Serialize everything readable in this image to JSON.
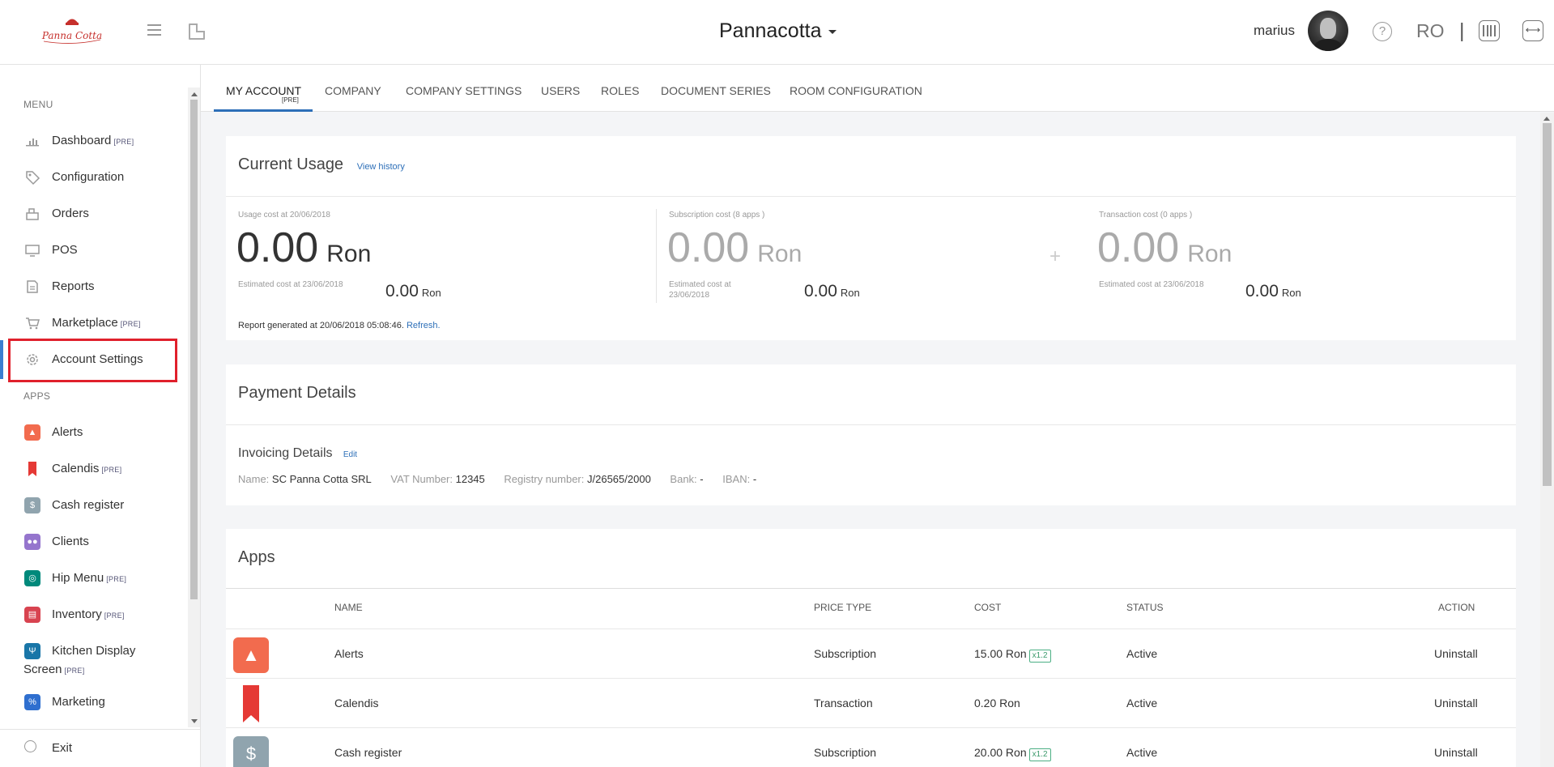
{
  "header": {
    "logo_text": "Panna Cotta",
    "company_name": "Pannacotta",
    "user_name": "marius",
    "help_glyph": "?",
    "language": "RO",
    "separator": "|"
  },
  "sidebar": {
    "menu_title": "MENU",
    "apps_title": "APPS",
    "pre_badge": "[PRE]",
    "menu_items": [
      {
        "label": "Dashboard",
        "pre": "[PRE]",
        "icon": "bar-chart-icon"
      },
      {
        "label": "Configuration",
        "pre": "",
        "icon": "tag-icon"
      },
      {
        "label": "Orders",
        "pre": "",
        "icon": "orders-icon"
      },
      {
        "label": "POS",
        "pre": "",
        "icon": "monitor-icon"
      },
      {
        "label": "Reports",
        "pre": "",
        "icon": "reports-icon"
      },
      {
        "label": "Marketplace",
        "pre": "[PRE]",
        "icon": "cart-icon"
      },
      {
        "label": "Account Settings",
        "pre": "",
        "icon": "gear-icon"
      }
    ],
    "app_items": [
      {
        "label": "Alerts",
        "pre": "",
        "icon": "bell-icon",
        "color": "#f26b4e",
        "glyph": "🔔"
      },
      {
        "label": "Calendis",
        "pre": "[PRE]",
        "icon": "bookmark-icon",
        "color": "#e53935",
        "glyph": ""
      },
      {
        "label": "Cash register",
        "pre": "",
        "icon": "coins-icon",
        "color": "#90a4ae",
        "glyph": "$"
      },
      {
        "label": "Clients",
        "pre": "",
        "icon": "users-icon",
        "color": "#9575cd",
        "glyph": "●●"
      },
      {
        "label": "Hip Menu",
        "pre": "[PRE]",
        "icon": "compass-icon",
        "color": "#00897b",
        "glyph": "◎"
      },
      {
        "label": "Inventory",
        "pre": "[PRE]",
        "icon": "inventory-icon",
        "color": "#d84350",
        "glyph": "▤"
      },
      {
        "label": "Kitchen Display",
        "label2": "Screen",
        "pre": "[PRE]",
        "icon": "cutlery-icon",
        "color": "#1976a8",
        "glyph": "Ψ"
      },
      {
        "label": "Marketing",
        "pre": "",
        "icon": "marketing-icon",
        "color": "#2f6fcf",
        "glyph": "%"
      }
    ],
    "exit_label": "Exit"
  },
  "tabs": [
    {
      "label": "MY ACCOUNT",
      "pre": "[PRE]"
    },
    {
      "label": "COMPANY"
    },
    {
      "label": "COMPANY SETTINGS"
    },
    {
      "label": "USERS"
    },
    {
      "label": "ROLES"
    },
    {
      "label": "DOCUMENT SERIES"
    },
    {
      "label": "ROOM CONFIGURATION"
    }
  ],
  "usage": {
    "title": "Current Usage",
    "history_link": "View history",
    "plus": "+",
    "columns": [
      {
        "label": "Usage cost at 20/06/2018",
        "value": "0.00",
        "unit": "Ron",
        "est_label": "Estimated cost at 23/06/2018",
        "est_label2": "",
        "est_value": "0.00",
        "est_unit": "Ron"
      },
      {
        "label": "Subscription cost (8 apps )",
        "value": "0.00",
        "unit": "Ron",
        "est_label": "Estimated cost at",
        "est_label2": "23/06/2018",
        "est_value": "0.00",
        "est_unit": "Ron"
      },
      {
        "label": "Transaction cost (0 apps )",
        "value": "0.00",
        "unit": "Ron",
        "est_label": "Estimated cost at 23/06/2018",
        "est_label2": "",
        "est_value": "0.00",
        "est_unit": "Ron"
      }
    ],
    "report_text": "Report generated at 20/06/2018 05:08:46.",
    "refresh_link": "Refresh."
  },
  "payment": {
    "title": "Payment Details",
    "invoicing_title": "Invoicing Details",
    "edit_link": "Edit",
    "fields": [
      {
        "label": "Name:",
        "value": "SC Panna Cotta SRL"
      },
      {
        "label": "VAT Number:",
        "value": "12345"
      },
      {
        "label": "Registry number:",
        "value": "J/26565/2000"
      },
      {
        "label": "Bank:",
        "value": "-"
      },
      {
        "label": "IBAN:",
        "value": "-"
      }
    ]
  },
  "apps_table": {
    "title": "Apps",
    "headers": {
      "name": "NAME",
      "price_type": "PRICE TYPE",
      "cost": "COST",
      "status": "STATUS",
      "action": "ACTION"
    },
    "rows": [
      {
        "name": "Alerts",
        "price_type": "Subscription",
        "cost": "15.00 Ron",
        "multiplier": "x1.2",
        "status": "Active",
        "action": "Uninstall",
        "icon": "bell-icon",
        "color": "#f26b4e"
      },
      {
        "name": "Calendis",
        "price_type": "Transaction",
        "cost": "0.20 Ron",
        "multiplier": "",
        "status": "Active",
        "action": "Uninstall",
        "icon": "bookmark-icon",
        "color": "#e53935"
      },
      {
        "name": "Cash register",
        "price_type": "Subscription",
        "cost": "20.00 Ron",
        "multiplier": "x1.2",
        "status": "Active",
        "action": "Uninstall",
        "icon": "coins-icon",
        "color": "#90a4ae"
      }
    ]
  },
  "colors": {
    "accent": "#2d6fb8",
    "highlight": "#e0202c",
    "uninstall": "#c53030",
    "multiplier": "#3c9a6c"
  }
}
